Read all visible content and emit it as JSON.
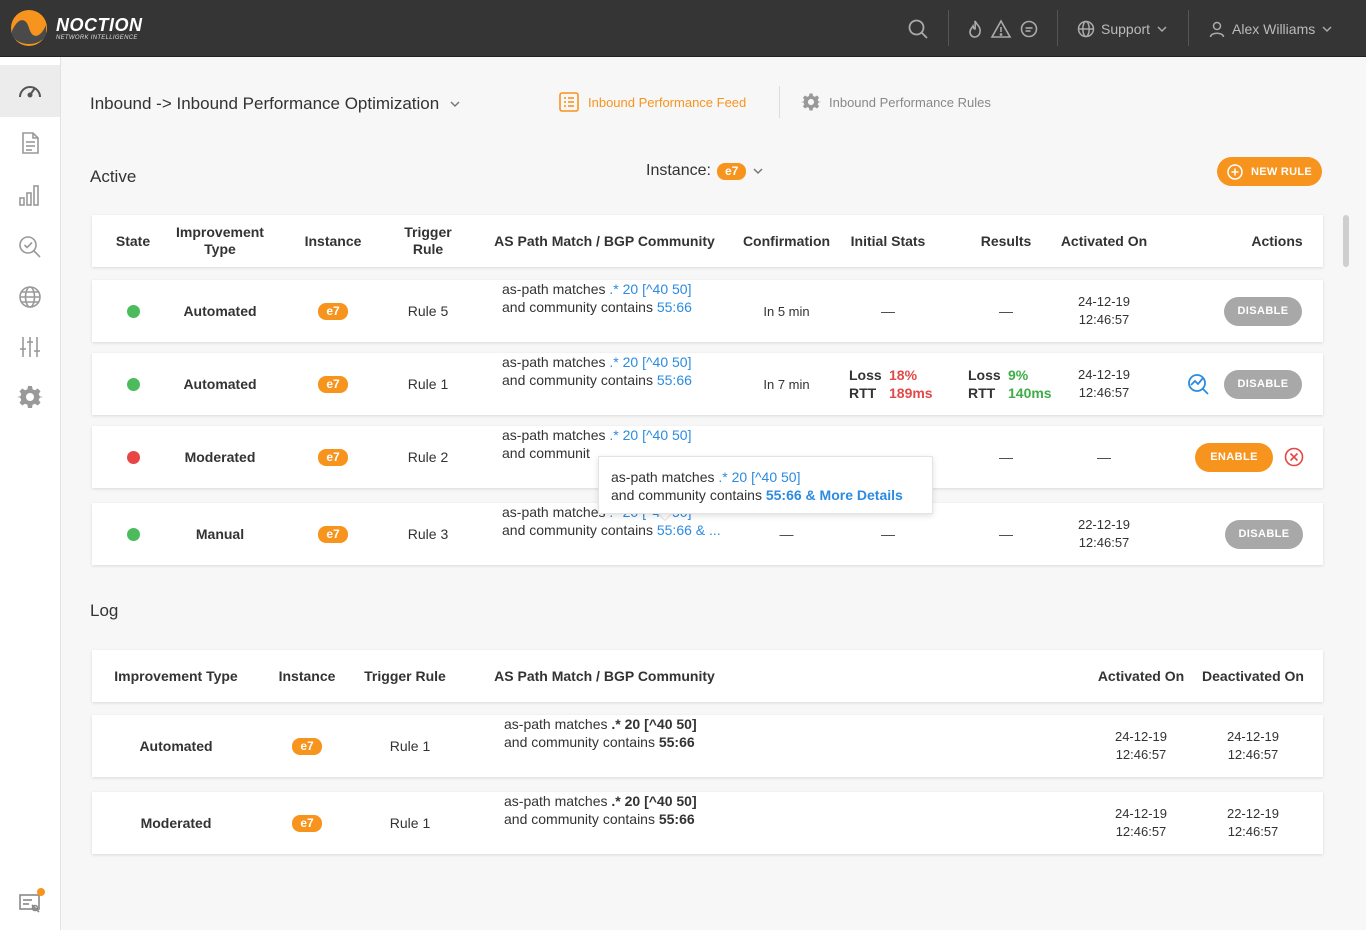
{
  "brand": {
    "name": "NOCTION",
    "tagline": "NETWORK INTELLIGENCE"
  },
  "topbar": {
    "support_label": "Support",
    "user_name": "Alex Williams"
  },
  "page": {
    "title": "Inbound -> Inbound Performance Optimization",
    "tabs": [
      {
        "label": "Inbound Performance Feed"
      },
      {
        "label": "Inbound Performance Rules"
      }
    ]
  },
  "active": {
    "title": "Active",
    "instance_label": "Instance:",
    "instance_value": "e7",
    "new_rule_label": "NEW RULE",
    "headers": {
      "state": "State",
      "improvement_type": "Improvement Type",
      "instance": "Instance",
      "trigger_rule": "Trigger Rule",
      "as_path": "AS Path Match / BGP Community",
      "confirmation": "Confirmation",
      "initial_stats": "Initial Stats",
      "results": "Results",
      "activated_on": "Activated On",
      "actions": "Actions"
    },
    "rows": [
      {
        "state": "active",
        "type": "Automated",
        "instance": "e7",
        "rule": "Rule 5",
        "path_prefix": "as-path matches",
        "path_value": ".* 20 [^40 50]",
        "community_prefix": "and community contains",
        "community_value": "55:66",
        "confirmation": "In 5 min",
        "initial": "—",
        "results": "—",
        "date": "24-12-19",
        "time": "12:46:57",
        "action": "DISABLE"
      },
      {
        "state": "active",
        "type": "Automated",
        "instance": "e7",
        "rule": "Rule 1",
        "path_prefix": "as-path matches",
        "path_value": ".* 20 [^40 50]",
        "community_prefix": "and community contains",
        "community_value": "55:66",
        "confirmation": "In 7 min",
        "initial_loss_label": "Loss",
        "initial_loss": "18%",
        "initial_rtt_label": "RTT",
        "initial_rtt": "189ms",
        "result_loss_label": "Loss",
        "result_loss": "9%",
        "result_rtt_label": "RTT",
        "result_rtt": "140ms",
        "date": "24-12-19",
        "time": "12:46:57",
        "action": "DISABLE"
      },
      {
        "state": "inactive",
        "type": "Moderated",
        "instance": "e7",
        "rule": "Rule 2",
        "path_prefix": "as-path matches",
        "path_value": ".* 20 [^40 50]",
        "community_prefix": "and communit",
        "results": "—",
        "activated": "—",
        "action": "ENABLE"
      },
      {
        "state": "active",
        "type": "Manual",
        "instance": "e7",
        "rule": "Rule 3",
        "path_prefix": "as-path matches",
        "path_value": ".* 20 [^40 50]",
        "community_prefix": "and community contains",
        "community_value": "55:66 & ...",
        "confirmation": "—",
        "initial": "—",
        "results": "—",
        "date": "22-12-19",
        "time": "12:46:57",
        "action": "DISABLE"
      }
    ],
    "tooltip": {
      "path_prefix": "as-path matches",
      "path_value": ".* 20 [^40 50]",
      "community_prefix": "and community contains",
      "community_value": "55:66 & More Details"
    }
  },
  "log": {
    "title": "Log",
    "headers": {
      "improvement_type": "Improvement Type",
      "instance": "Instance",
      "trigger_rule": "Trigger Rule",
      "as_path": "AS Path Match / BGP Community",
      "activated_on": "Activated On",
      "deactivated_on": "Deactivated On"
    },
    "rows": [
      {
        "type": "Automated",
        "instance": "e7",
        "rule": "Rule 1",
        "path_prefix": "as-path matches",
        "path_value": ".* 20 [^40 50]",
        "community_prefix": "and community contains",
        "community_value": "55:66",
        "act_date": "24-12-19",
        "act_time": "12:46:57",
        "deact_date": "24-12-19",
        "deact_time": "12:46:57"
      },
      {
        "type": "Moderated",
        "instance": "e7",
        "rule": "Rule 1",
        "path_prefix": "as-path matches",
        "path_value": ".* 20 [^40 50]",
        "community_prefix": "and community contains",
        "community_value": "55:66",
        "act_date": "24-12-19",
        "act_time": "12:46:57",
        "deact_date": "22-12-19",
        "deact_time": "12:46:57"
      }
    ]
  },
  "colors": {
    "accent": "#f7941d",
    "link": "#2b8be0",
    "ok": "#4cbb5c",
    "error": "#e84545"
  },
  "icons": {
    "sidebar": [
      "dashboard-icon",
      "report-icon",
      "bar-chart-icon",
      "search-check-icon",
      "globe-icon",
      "sliders-icon",
      "gear-icon",
      "notifications-icon"
    ],
    "topbar": [
      "search-icon",
      "fire-icon",
      "warning-icon",
      "chat-icon",
      "support-globe-icon",
      "user-icon"
    ]
  }
}
